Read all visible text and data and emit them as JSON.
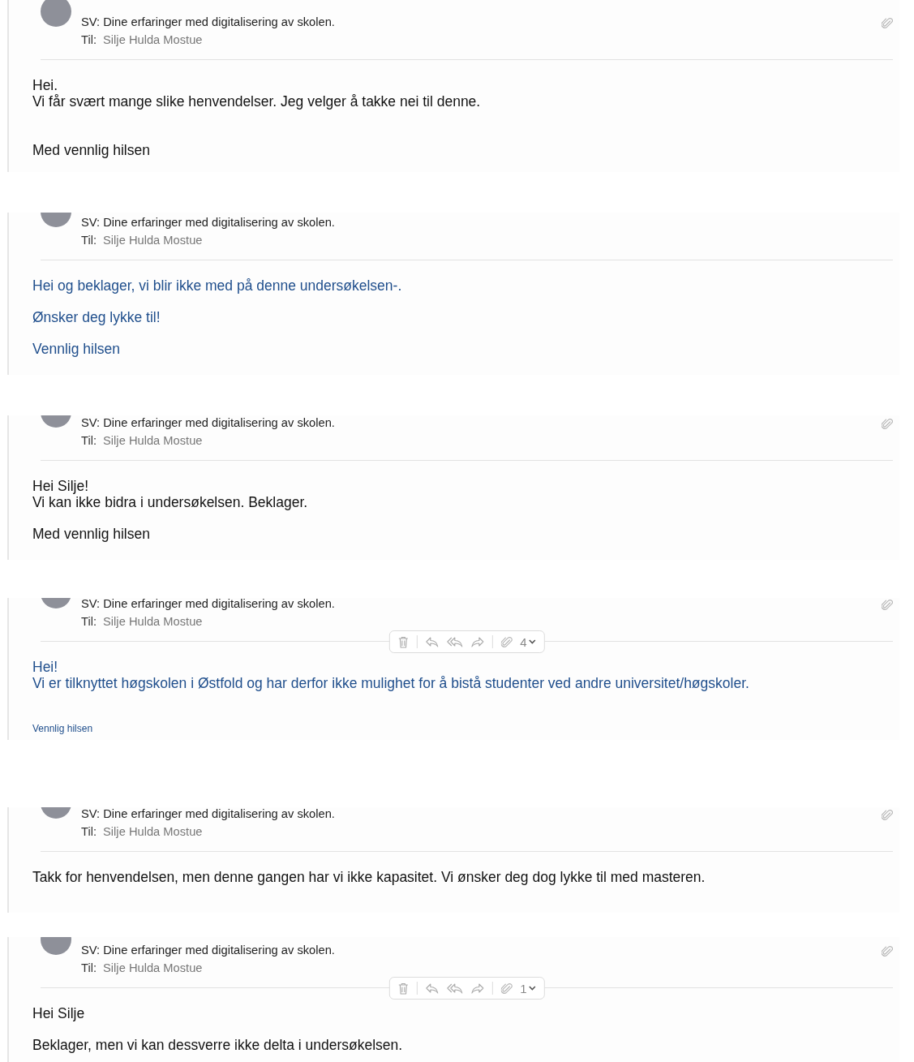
{
  "emails": [
    {
      "subject": "SV: Dine erfaringer med digitalisering av skolen.",
      "to_label": "Til:",
      "to": "Silje Hulda Mostue",
      "has_attachment": true,
      "color": "#111111",
      "body": [
        {
          "lines": [
            "Hei.",
            "Vi får svært mange slike henvendelser. Jeg velger å takke nei til denne."
          ]
        },
        {
          "kind": "far",
          "lines": [
            "Med vennlig hilsen"
          ]
        }
      ]
    },
    {
      "subject": "SV: Dine erfaringer med digitalisering av skolen.",
      "to_label": "Til:",
      "to": "Silje Hulda Mostue",
      "has_attachment": false,
      "color": "#1f4e8c",
      "body": [
        {
          "lines": [
            "Hei og beklager, vi blir ikke med på denne undersøkelsen-."
          ]
        },
        {
          "lines": [
            "Ønsker deg lykke til!"
          ]
        },
        {
          "lines": [
            "Vennlig hilsen"
          ]
        }
      ]
    },
    {
      "subject": "SV: Dine erfaringer med digitalisering av skolen.",
      "to_label": "Til:",
      "to": "Silje Hulda Mostue",
      "has_attachment": true,
      "color": "#111111",
      "body": [
        {
          "lines": [
            "Hei Silje!",
            "Vi kan ikke bidra i undersøkelsen. Beklager."
          ]
        },
        {
          "lines": [
            "Med vennlig hilsen"
          ]
        }
      ]
    },
    {
      "subject": "SV: Dine erfaringer med digitalisering av skolen.",
      "to_label": "Til:",
      "to": "Silje Hulda Mostue",
      "has_attachment": true,
      "toolbar": {
        "attachment_count": "4"
      },
      "color": "#1f4e8c",
      "body": [
        {
          "lines": [
            "Hei!",
            "Vi er tilknyttet høgskolen i Østfold og har derfor ikke mulighet for å bistå studenter ved andre universitet/høgskoler."
          ]
        },
        {
          "kind": "small",
          "lines": [
            "Vennlig hilsen"
          ]
        }
      ]
    },
    {
      "subject": "SV: Dine erfaringer med digitalisering av skolen.",
      "to_label": "Til:",
      "to": "Silje Hulda Mostue",
      "has_attachment": true,
      "color": "#111111",
      "body": [
        {
          "lines": [
            "Takk for henvendelsen, men denne gangen har vi ikke kapasitet. Vi ønsker deg dog lykke til med masteren."
          ]
        }
      ]
    },
    {
      "subject": "SV: Dine erfaringer med digitalisering av skolen.",
      "to_label": "Til:",
      "to": "Silje Hulda Mostue",
      "has_attachment": true,
      "toolbar": {
        "attachment_count": "1"
      },
      "color": "#111111",
      "body": [
        {
          "lines": [
            "Hei Silje"
          ]
        },
        {
          "lines": [
            "Beklager, men vi kan dessverre ikke delta i undersøkelsen."
          ]
        }
      ]
    }
  ]
}
